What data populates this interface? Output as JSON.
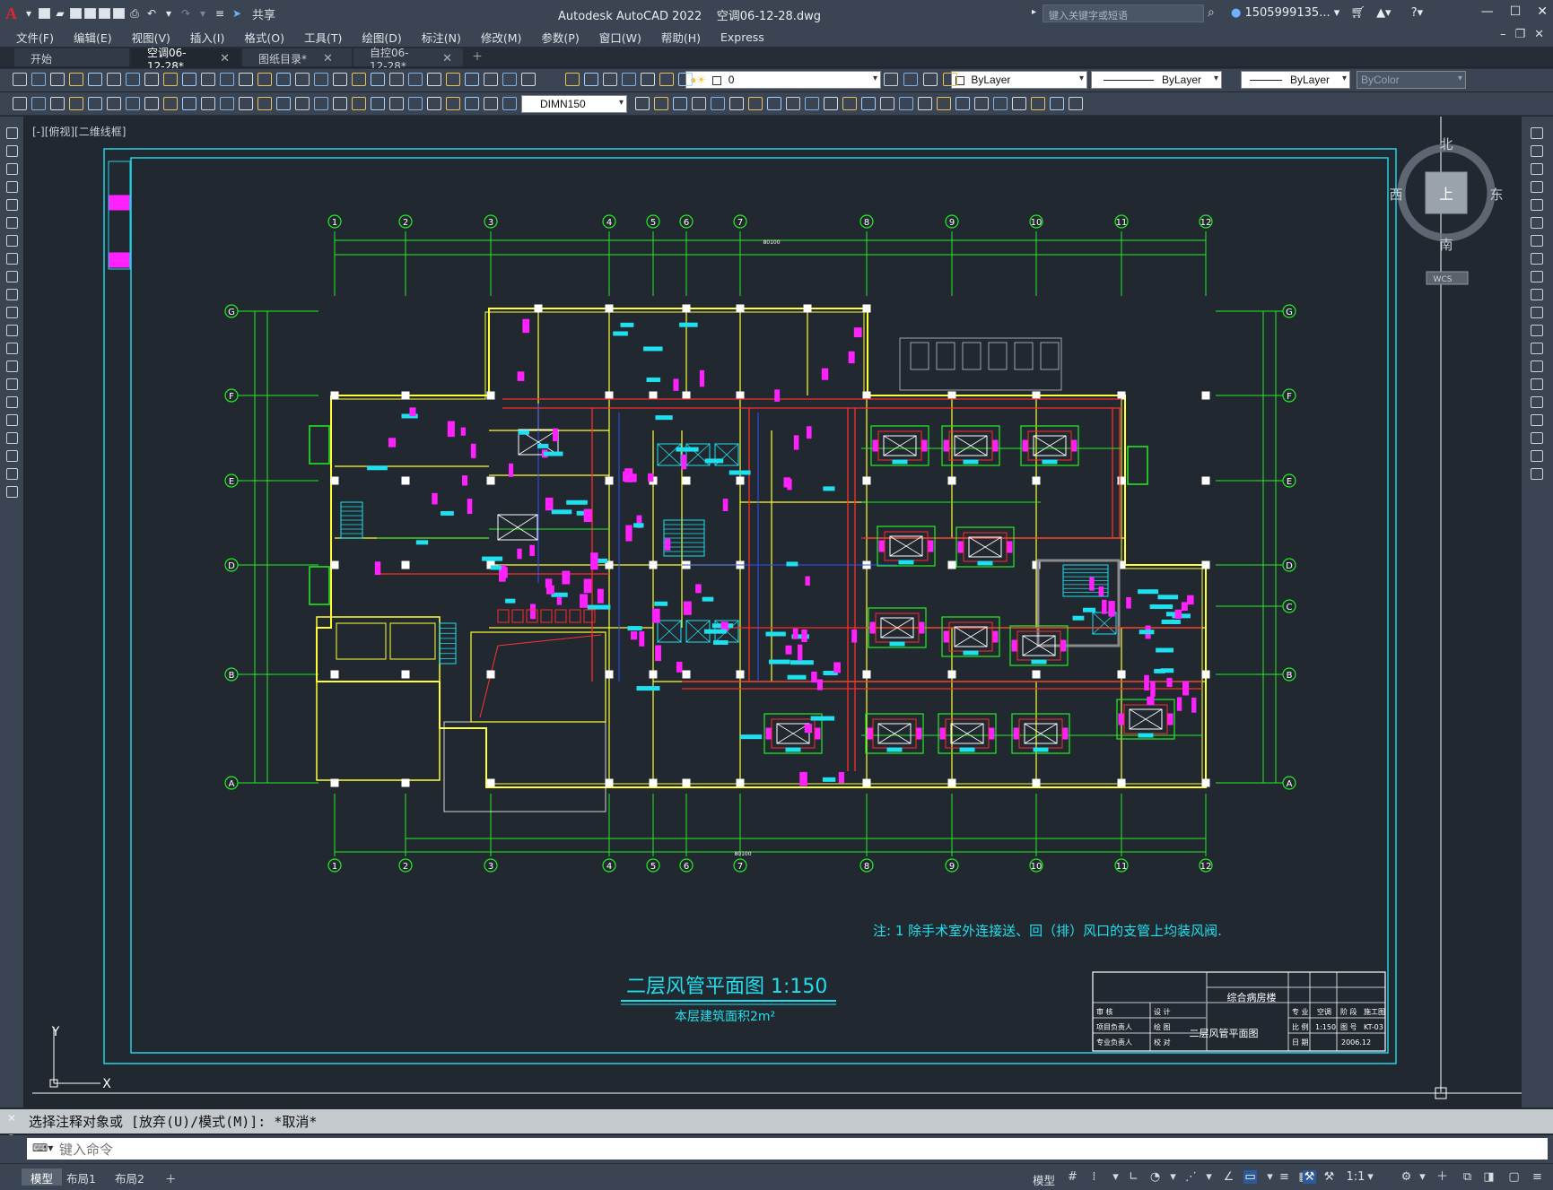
{
  "titlebar": {
    "app_logo": "A",
    "share": "共享",
    "title": "Autodesk AutoCAD 2022    空调06-12-28.dwg",
    "search_placeholder": "键入关键字或短语",
    "user": "1505999135..."
  },
  "menu": [
    "文件(F)",
    "编辑(E)",
    "视图(V)",
    "插入(I)",
    "格式(O)",
    "工具(T)",
    "绘图(D)",
    "标注(N)",
    "修改(M)",
    "参数(P)",
    "窗口(W)",
    "帮助(H)",
    "Express"
  ],
  "tabs": [
    {
      "label": "开始",
      "active": false,
      "closable": false
    },
    {
      "label": "空调06-12-28*",
      "active": true,
      "closable": true
    },
    {
      "label": "图纸目录*",
      "active": false,
      "closable": true
    },
    {
      "label": "自控06-12-28*",
      "active": false,
      "closable": true
    }
  ],
  "toolbar": {
    "layer_value": "0",
    "color_value": "ByLayer",
    "linetype_value": "ByLayer",
    "lineweight_value": "ByLayer",
    "plotstyle_value": "ByColor",
    "dimstyle_value": "DIMN150"
  },
  "viewport": {
    "label": "[-][俯视][二维线框]",
    "viewcube": {
      "north": "北",
      "south": "南",
      "east": "东",
      "west": "西",
      "face": "上",
      "wcs": "WCS"
    },
    "ucs": {
      "x": "X",
      "y": "Y"
    }
  },
  "drawing": {
    "grid_cols": [
      "1",
      "2",
      "3",
      "4",
      "5",
      "6",
      "7",
      "8",
      "9",
      "10",
      "11",
      "12"
    ],
    "grid_rows_left": [
      "G",
      "F",
      "E",
      "D",
      "B",
      "A"
    ],
    "grid_rows_right": [
      "G",
      "F",
      "E",
      "D",
      "C",
      "B",
      "A"
    ],
    "overall_dim": "80100",
    "note": "注: 1 除手术室外连接送、回（排）风口的支管上均装风阀.",
    "title": "二层风管平面图   1:150",
    "subtitle": "本层建筑面积2m²",
    "title_block": {
      "project": "综合病房楼",
      "drawing_name": "二层风管平面图",
      "scale": "1:150",
      "discipline": "空调",
      "stage": "施工图",
      "sheet_no": "KT-03",
      "date": "2006.12",
      "labels": [
        "审 核",
        "设 计",
        "项目负责人",
        "绘 图",
        "专业负责人",
        "校 对",
        "专 业",
        "阶 段",
        "比 例",
        "图 号",
        "日 期"
      ]
    }
  },
  "command": {
    "history": "选择注释对象或 [放弃(U)/模式(M)]: *取消*",
    "placeholder": "键入命令"
  },
  "statusbar": {
    "layout_tabs": [
      {
        "label": "模型",
        "active": true
      },
      {
        "label": "布局1",
        "active": false
      },
      {
        "label": "布局2",
        "active": false
      }
    ],
    "model_label": "模型",
    "scale": "1:1"
  },
  "colors": {
    "frame": "#22d3e6",
    "walls": "#ffff33",
    "grid": "#22ee22",
    "duct": "#ff2b2b",
    "terminal": "#ff22ff",
    "cyan": "#1ee0ee"
  }
}
